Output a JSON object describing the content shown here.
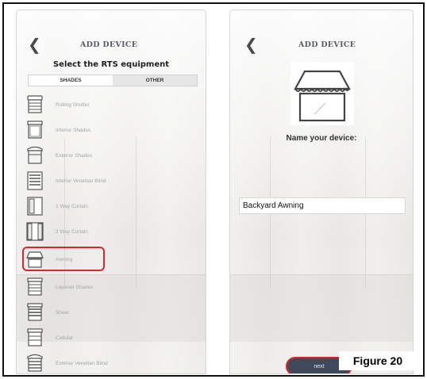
{
  "left_screen": {
    "header": {
      "back_icon": "chevron-left-icon",
      "title": "ADD DEVICE"
    },
    "subtitle": "Select the RTS equipment",
    "tabs": [
      {
        "label": "SHADES",
        "active": true
      },
      {
        "label": "OTHER",
        "active": false
      }
    ],
    "devices": [
      {
        "label": "Rolling Shutter",
        "icon": "rolling-shutter-icon"
      },
      {
        "label": "Interior Shades",
        "icon": "interior-shades-icon"
      },
      {
        "label": "Exterior Shades",
        "icon": "exterior-shades-icon"
      },
      {
        "label": "Interior Venetian Blind",
        "icon": "venetian-blind-icon"
      },
      {
        "label": "1 Way Curtain",
        "icon": "one-way-curtain-icon"
      },
      {
        "label": "2 Way Curtain",
        "icon": "two-way-curtain-icon"
      },
      {
        "label": "Awning",
        "icon": "awning-icon",
        "highlighted": true
      },
      {
        "label": "Layered Shades",
        "icon": "layered-shades-icon"
      },
      {
        "label": "Sheer",
        "icon": "sheer-icon"
      },
      {
        "label": "Cellular",
        "icon": "cellular-icon"
      },
      {
        "label": "Exterior Venetian Blind",
        "icon": "exterior-venetian-blind-icon"
      }
    ],
    "highlight_color": "#d8262c"
  },
  "right_screen": {
    "header": {
      "back_icon": "chevron-left-icon",
      "title": "ADD DEVICE"
    },
    "device_icon": "awning-icon",
    "name_label": "Name your device:",
    "name_value": "Backyard Awning",
    "next_label": "next",
    "next_button_color": "#3e4a5b"
  },
  "figure_label": "Figure 20"
}
